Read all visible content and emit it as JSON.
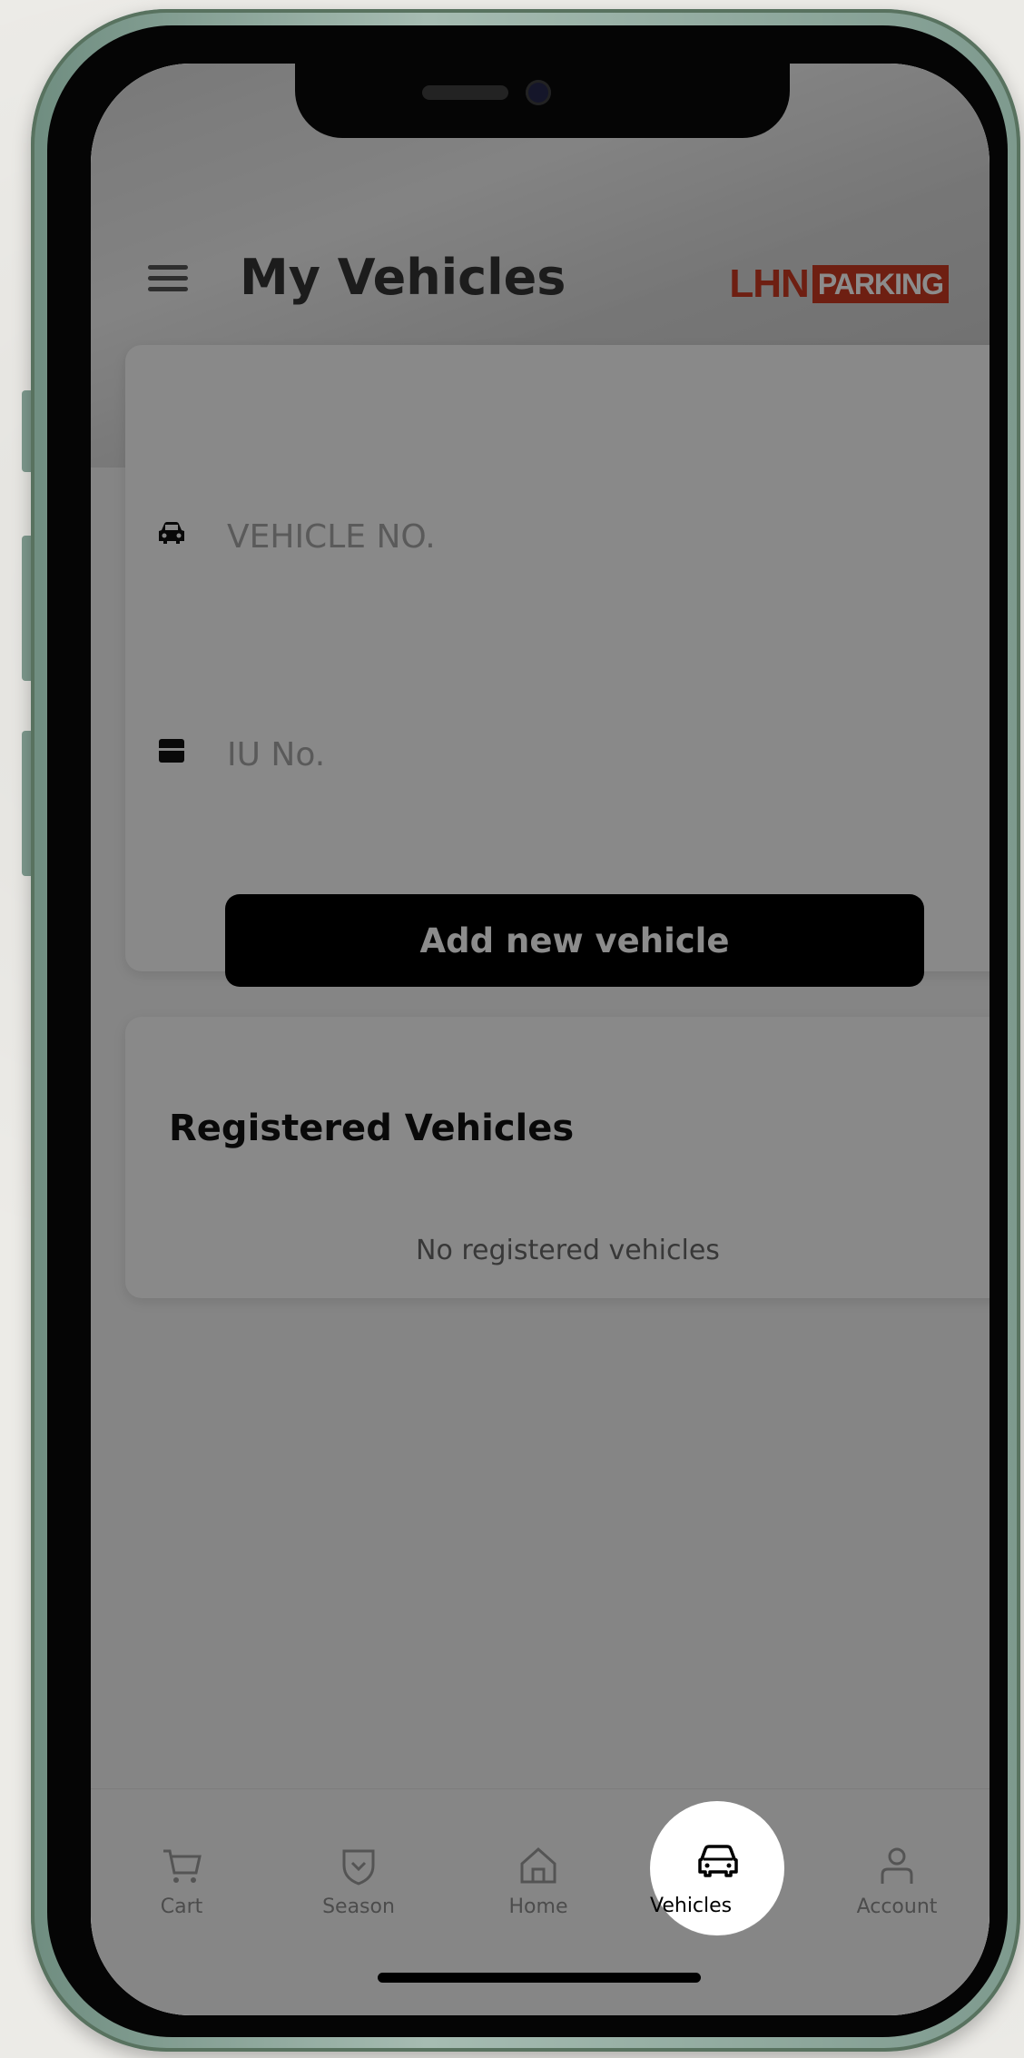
{
  "header": {
    "title": "My Vehicles",
    "logo": {
      "part1": "LHN",
      "part2": "PARKING"
    },
    "brand_color": "#c83a22"
  },
  "form": {
    "vehicle_no": {
      "placeholder": "VEHICLE NO.",
      "value": "",
      "icon": "car-icon"
    },
    "iu_no": {
      "placeholder": "IU No.",
      "value": "",
      "icon": "box-icon"
    },
    "add_button_label": "Add new vehicle"
  },
  "registered": {
    "title": "Registered Vehicles",
    "empty_text": "No registered vehicles"
  },
  "nav": {
    "items": [
      {
        "label": "Cart",
        "icon": "cart-icon"
      },
      {
        "label": "Season",
        "icon": "season-pass-icon"
      },
      {
        "label": "Home",
        "icon": "home-icon"
      },
      {
        "label": "Vehicles",
        "icon": "car-icon"
      },
      {
        "label": "Account",
        "icon": "user-icon"
      }
    ],
    "active": "Vehicles"
  }
}
